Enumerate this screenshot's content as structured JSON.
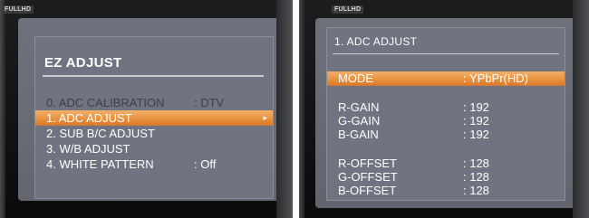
{
  "left_photo": {
    "logo": "FULLHD",
    "panel": {
      "title": "EZ ADJUST",
      "items": [
        {
          "label": "0. ADC CALIBRATION",
          "value": ": DTV",
          "state": "dim"
        },
        {
          "label": "1. ADC ADJUST",
          "value": "",
          "state": "selected"
        },
        {
          "label": "2. SUB B/C ADJUST",
          "value": "",
          "state": "normal"
        },
        {
          "label": "3. W/B ADJUST",
          "value": "",
          "state": "normal"
        },
        {
          "label": "4. WHITE PATTERN",
          "value": ": Off",
          "state": "normal"
        }
      ],
      "selected_arrow": "▸"
    }
  },
  "right_photo": {
    "logo": "FULLHD",
    "panel": {
      "title": "1. ADC ADJUST",
      "mode": {
        "label": "MODE",
        "value": ": YPbPr(HD)"
      },
      "gain": [
        {
          "label": "R-GAIN",
          "value": ": 192"
        },
        {
          "label": "G-GAIN",
          "value": ": 192"
        },
        {
          "label": "B-GAIN",
          "value": ": 192"
        }
      ],
      "offset": [
        {
          "label": "R-OFFSET",
          "value": ": 128"
        },
        {
          "label": "G-OFFSET",
          "value": ": 128"
        },
        {
          "label": "B-OFFSET",
          "value": ": 128"
        }
      ]
    }
  }
}
